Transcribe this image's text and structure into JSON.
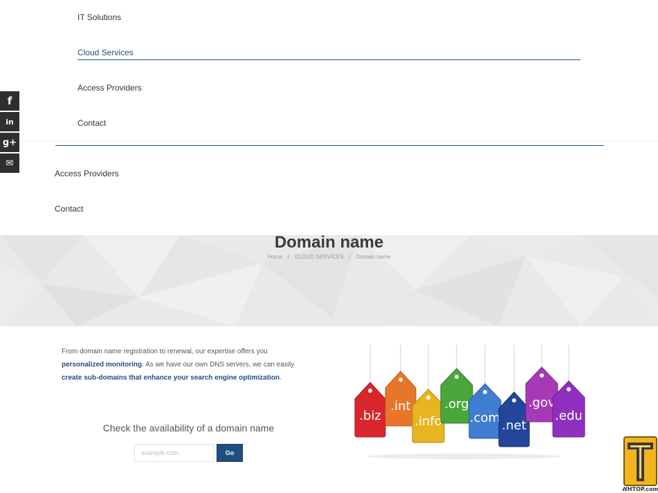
{
  "submenu": {
    "items": [
      "IT Solutions",
      "Cloud Services",
      "Access Providers",
      "Contact"
    ]
  },
  "menu": {
    "items": [
      "Access Providers",
      "Contact"
    ]
  },
  "social": {
    "facebook": "f",
    "linkedin": "in",
    "googleplus": "g+",
    "email": "✉"
  },
  "page": {
    "title": "Domain name",
    "breadcrumb": [
      "Home",
      "CLOUD SERVICES",
      "Domain name"
    ],
    "breadcrumb_sep": "/"
  },
  "intro": {
    "text1": "From domain name registration to renewal, our expertise offers you ",
    "bold1": "personalized monitoring",
    "text2": ". As we have our own DNS servers, we can easily ",
    "bold2": "create sub-domains that enhance your search engine optimization",
    "text3": "."
  },
  "domain_check": {
    "title": "Check the availability of a domain name",
    "placeholder": "example.com",
    "button": "Go"
  },
  "tags": [
    ".biz",
    ".int",
    ".info",
    ".org",
    ".com",
    ".net",
    ".gov",
    ".edu"
  ],
  "watermark": {
    "text": "WHTOP.com"
  },
  "colors": {
    "accent": "#1f4f80",
    "tag_biz": "#d9262e",
    "tag_int": "#e8762a",
    "tag_info": "#e6b51f",
    "tag_org": "#4aa63c",
    "tag_com": "#3f7ed0",
    "tag_net": "#23459a",
    "tag_gov": "#a63ab6",
    "tag_edu": "#8f2fc0"
  }
}
